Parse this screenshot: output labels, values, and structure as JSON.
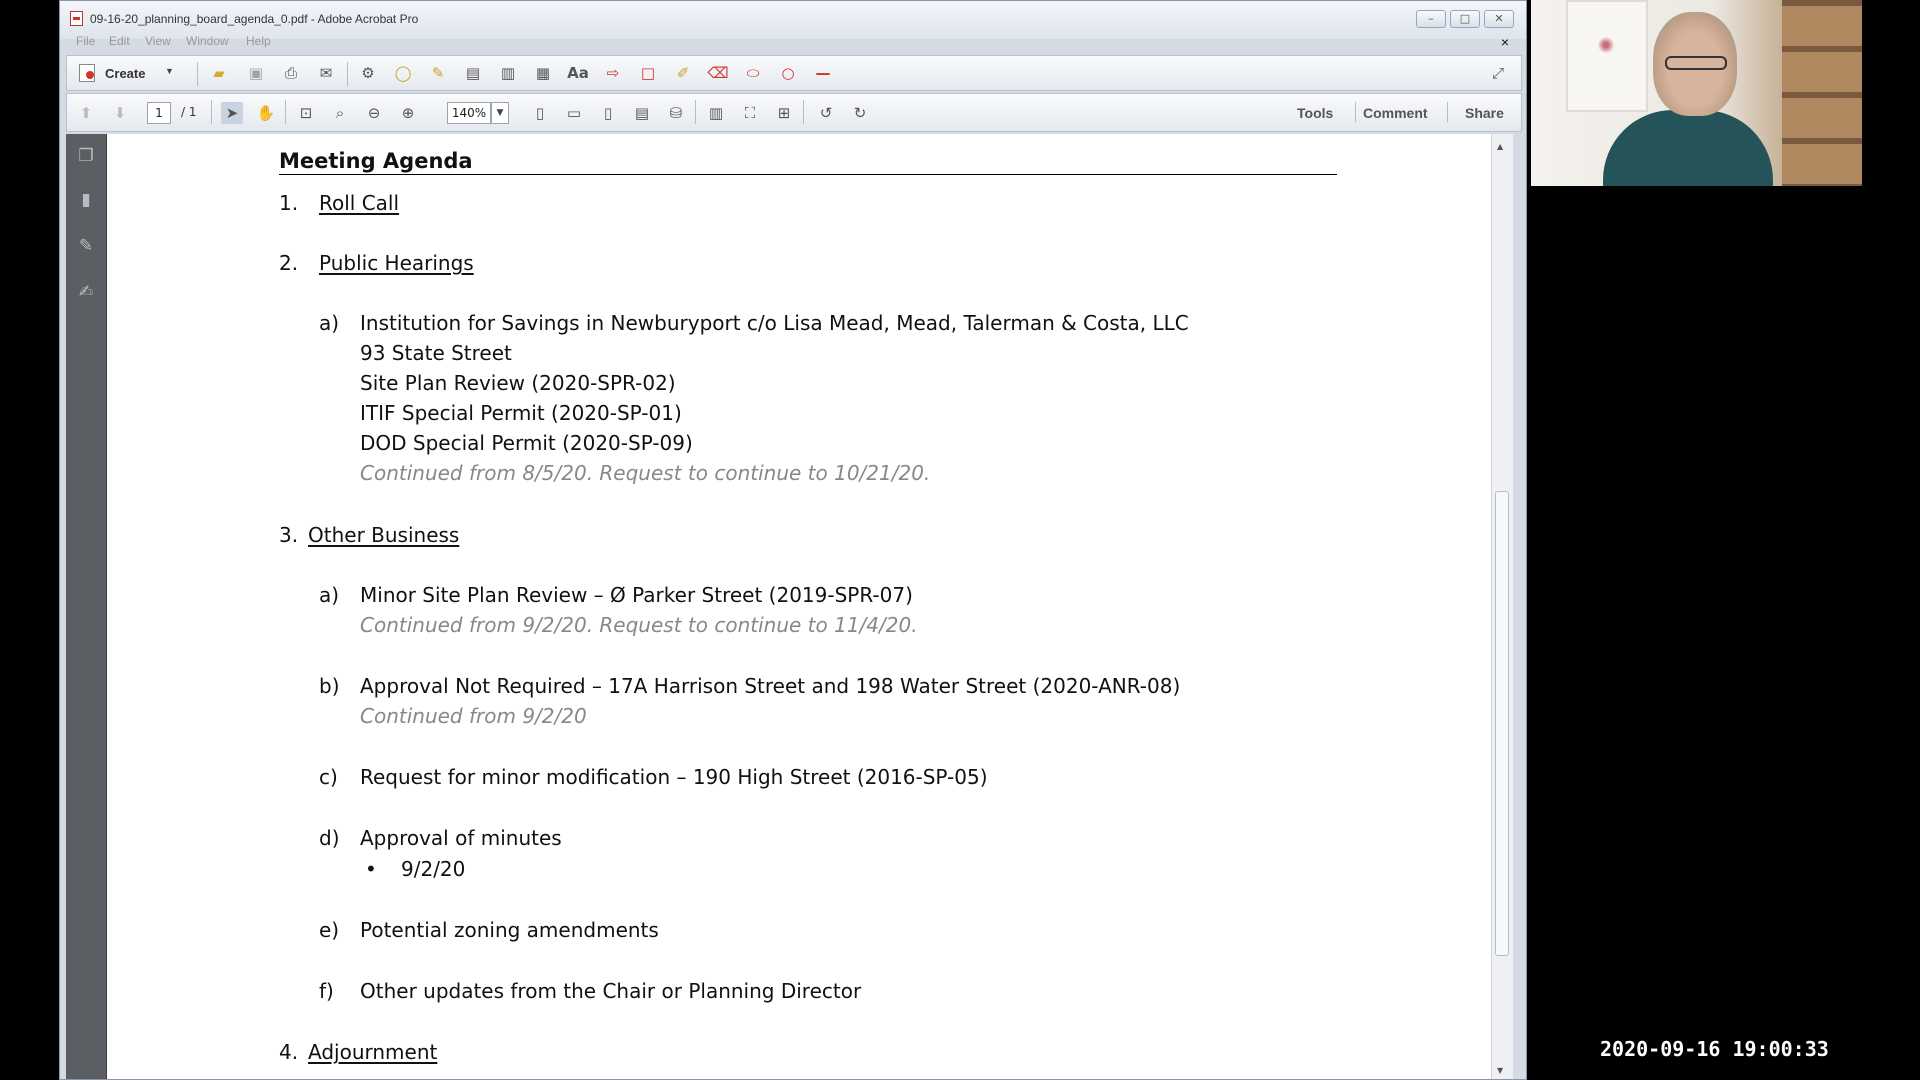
{
  "window": {
    "title": "09-16-20_planning_board_agenda_0.pdf - Adobe Acrobat Pro",
    "minimize": "–",
    "maximize": "□",
    "close": "✕"
  },
  "menu": [
    "File",
    "Edit",
    "View",
    "Window",
    "Help"
  ],
  "menu_close": "×",
  "toolbar": {
    "create_label": "Create",
    "page_current": "1",
    "page_total": "/ 1",
    "zoom": "140%",
    "tools_label": "Tools",
    "comment_label": "Comment",
    "share_label": "Share"
  },
  "document": {
    "heading": "Meeting Agenda",
    "items": [
      {
        "num": "1.",
        "title": "Roll Call"
      },
      {
        "num": "2.",
        "title": "Public Hearings"
      },
      {
        "num": "3.",
        "title": "Other Business"
      },
      {
        "num": "4.",
        "title": "Adjournment"
      }
    ],
    "hearing_a": {
      "letter": "a)",
      "lines": [
        "Institution for Savings in Newburyport c/o Lisa Mead, Mead, Talerman & Costa, LLC",
        "93 State Street",
        "Site Plan Review (2020-SPR-02)",
        "ITIF Special Permit (2020-SP-01)",
        "DOD Special Permit (2020-SP-09)"
      ],
      "note": "Continued from 8/5/20.  Request to continue to 10/21/20."
    },
    "business": [
      {
        "letter": "a)",
        "text": "Minor Site Plan Review – Ø Parker Street (2019-SPR-07)",
        "note": "Continued from 9/2/20.  Request to continue to 11/4/20."
      },
      {
        "letter": "b)",
        "text": "Approval Not Required – 17A Harrison Street and 198 Water Street (2020-ANR-08)",
        "note": "Continued from 9/2/20"
      },
      {
        "letter": "c)",
        "text": "Request for minor modification – 190 High Street (2016-SP-05)"
      },
      {
        "letter": "d)",
        "text": "Approval of minutes",
        "bullet": "9/2/20"
      },
      {
        "letter": "e)",
        "text": "Potential zoning amendments"
      },
      {
        "letter": "f)",
        "text": "Other updates from the Chair or Planning Director"
      }
    ]
  },
  "timestamp": "2020-09-16 19:00:33",
  "icons": {
    "bullet": "•"
  }
}
